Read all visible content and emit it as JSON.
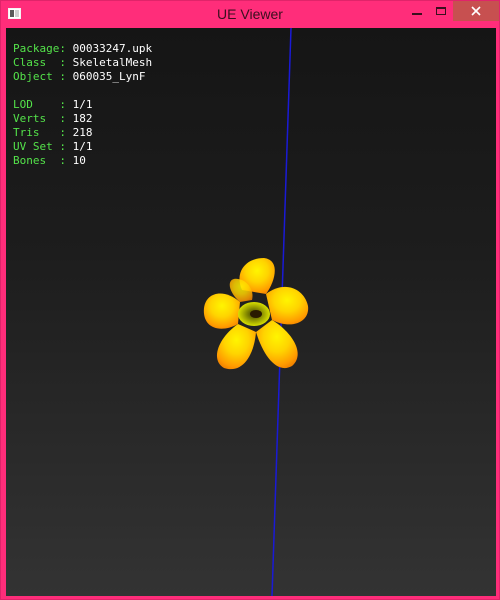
{
  "window": {
    "title": "UE Viewer"
  },
  "info": {
    "package": {
      "label": "Package:",
      "value": "00033247.upk"
    },
    "class": {
      "label": "Class  :",
      "value": "SkeletalMesh"
    },
    "object": {
      "label": "Object :",
      "value": "060035_LynF"
    },
    "lod": {
      "label": "LOD    :",
      "value": "1/1"
    },
    "verts": {
      "label": "Verts  :",
      "value": "182"
    },
    "tris": {
      "label": "Tris   :",
      "value": "218"
    },
    "uvset": {
      "label": "UV Set :",
      "value": "1/1"
    },
    "bones": {
      "label": "Bones  :",
      "value": "10"
    }
  },
  "colors": {
    "titlebar": "#ff2d7a",
    "label_green": "#54e34a",
    "axis_blue": "#1a1ad6",
    "flower_yellow": "#ffe000",
    "flower_orange": "#ff9a00"
  }
}
